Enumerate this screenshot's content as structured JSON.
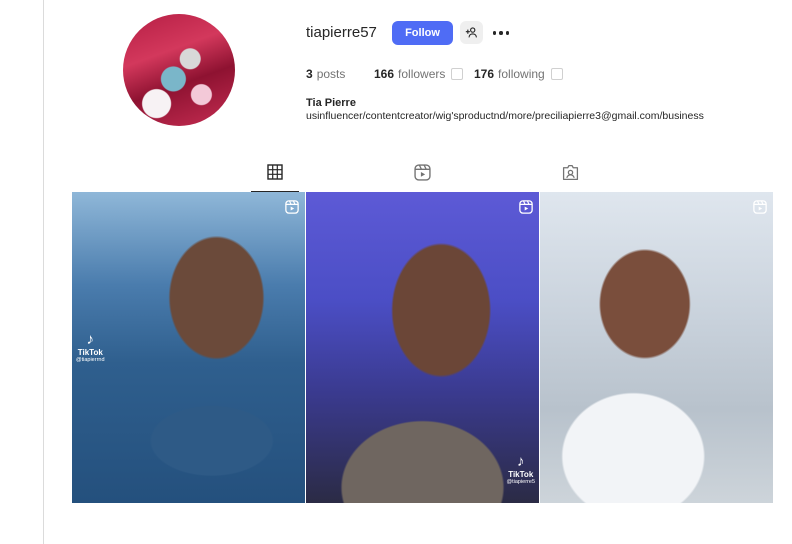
{
  "profile": {
    "username": "tiapierre57",
    "follow_label": "Follow",
    "posts_count": "3",
    "posts_label": "posts",
    "followers_count": "166",
    "followers_label": "followers",
    "following_count": "176",
    "following_label": "following",
    "full_name": "Tia Pierre",
    "bio": "usinfluencer/contentcreator/wig'sproductnd/more/preciliapierre3@gmail.com/business"
  },
  "tabs": [
    {
      "icon": "grid-icon",
      "active": true
    },
    {
      "icon": "reels-icon",
      "active": false
    },
    {
      "icon": "tagged-icon",
      "active": false
    }
  ],
  "posts": [
    {
      "type": "reel",
      "watermark": "TikTok",
      "handle": "@tiapierrnd"
    },
    {
      "type": "reel",
      "watermark": "TikTok",
      "handle": "@tiapierre5"
    },
    {
      "type": "reel",
      "watermark": "",
      "handle": ""
    }
  ],
  "colors": {
    "accent": "#4f6cf5",
    "text": "#262626",
    "muted": "#737373",
    "divider": "#dbdbdb"
  }
}
